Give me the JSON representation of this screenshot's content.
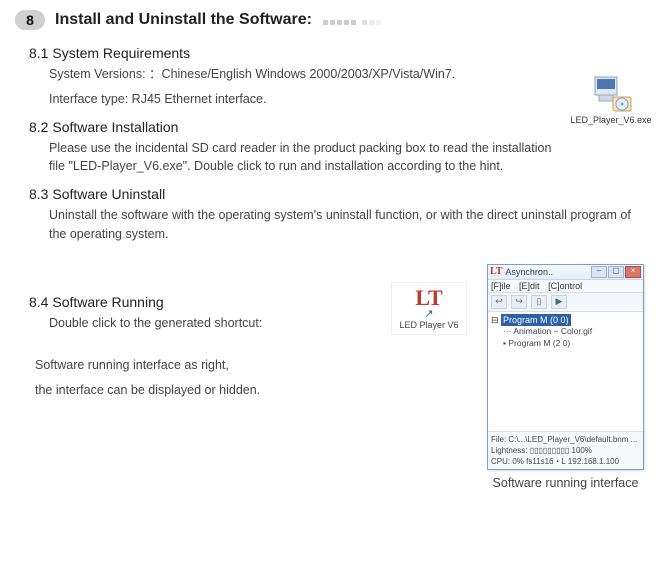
{
  "header": {
    "number": "8",
    "title": "Install and Uninstall the Software:"
  },
  "s81": {
    "heading": "8.1 System Requirements",
    "line1": "System Versions: ：Chinese/English Windows 2000/2003/XP/Vista/Win7.",
    "line2": "Interface type: RJ45 Ethernet interface."
  },
  "installer_icon_label": "LED_Player_V6.exe",
  "s82": {
    "heading": "8.2 Software Installation",
    "body": "Please use the incidental SD card reader in the product packing box to read the installation file \"LED-Player_V6.exe\". Double click to run and installation according to the hint."
  },
  "s83": {
    "heading": "8.3 Software Uninstall",
    "body": "Uninstall the software with the operating system's uninstall function, or with the direct uninstall program of the operating system."
  },
  "s84": {
    "heading": "8.4 Software Running",
    "line1": "Double click to the generated shortcut:",
    "line2": "Software running interface as right,",
    "line3": "the interface can be displayed or hidden."
  },
  "shortcut": {
    "logo": "LT",
    "label": "LED Player V6"
  },
  "app": {
    "title": "Asynchron..",
    "menu": {
      "file": "[F]ile",
      "edit": "[E]dit",
      "control": "[C]ontrol"
    },
    "toolbar": [
      "↩",
      "↪",
      "▯",
      "▶"
    ],
    "tree": {
      "root": "Program M (0 0)",
      "child1": "Animation − Color.gif",
      "child2": "Program M (2 0)"
    },
    "footer": {
      "file": "File:  C:\\...\\LED_Player_V6\\default.bnm ...",
      "lightness": "Lightness:  ▯▯▯▯▯▯▯▯▯  100%",
      "status": "CPU: 0%   fs11s16・L          192.168.1.100"
    }
  },
  "caption": "Software running interface"
}
